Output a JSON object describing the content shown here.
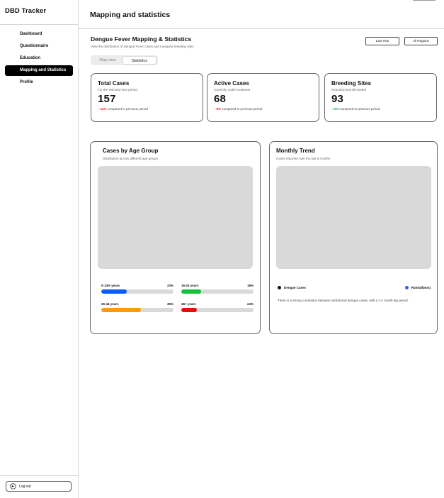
{
  "app": {
    "brand": "DBD Tracker"
  },
  "sidebar": {
    "items": [
      {
        "label": "Dashboard",
        "active": false
      },
      {
        "label": "Questionnaire",
        "active": false
      },
      {
        "label": "Education",
        "active": false
      },
      {
        "label": "Mapping and Statistics",
        "active": true
      },
      {
        "label": "Profile",
        "active": false
      }
    ],
    "logout_label": "Log out"
  },
  "header": {
    "title": "Mapping and statistics"
  },
  "section": {
    "title": "Dengue Fever Mapping & Statistics",
    "subtitle": "View the distribution of Dengue Fever cases and mosquito breeding sites",
    "filters": {
      "period": "Last Year",
      "region": "All Regions"
    }
  },
  "tabs": [
    {
      "label": "Map view",
      "active": false
    },
    {
      "label": "Statistics",
      "active": true
    }
  ],
  "stats": [
    {
      "title": "Total Cases",
      "subtitle": "For the selected time period",
      "value": "157",
      "arrow": "↑",
      "change": "12%",
      "change_text": "compared to previous period",
      "direction": "up"
    },
    {
      "title": "Active Cases",
      "subtitle": "Currently under treatment",
      "value": "68",
      "arrow": "↑",
      "change": "8%",
      "change_text": "compared to previous period",
      "direction": "up"
    },
    {
      "title": "Breeding Sites",
      "subtitle": "Reported and eliminated",
      "value": "93",
      "arrow": "↓",
      "change": "5%",
      "change_text": "compared to previous period",
      "direction": "down"
    }
  ],
  "age_panel": {
    "title": "Cases by Age Group",
    "subtitle": "Distribution across different age groups",
    "groups": [
      {
        "label": "0-14% years",
        "value_text": "23%",
        "fraction": 0.35,
        "color": "#0a5cff"
      },
      {
        "label": "15-24 years",
        "value_text": "18%",
        "fraction": 0.27,
        "color": "#12c43a"
      },
      {
        "label": "25-44 years",
        "value_text": "35%",
        "fraction": 0.55,
        "color": "#ff9a0a"
      },
      {
        "label": "45+ years",
        "value_text": "24%",
        "fraction": 0.22,
        "color": "#ee0a0a"
      }
    ]
  },
  "trend_panel": {
    "title": "Monthly Trend",
    "subtitle": "Cases reported over the last 6 months",
    "legend": [
      {
        "label": "Dengue Cases",
        "color": "#111111"
      },
      {
        "label": "Rainfall(mm)",
        "color": "#3a5cf0"
      }
    ],
    "note": "There is a strong correlation between rainfall and dengue cases, with a 1-2 month lag period."
  }
}
